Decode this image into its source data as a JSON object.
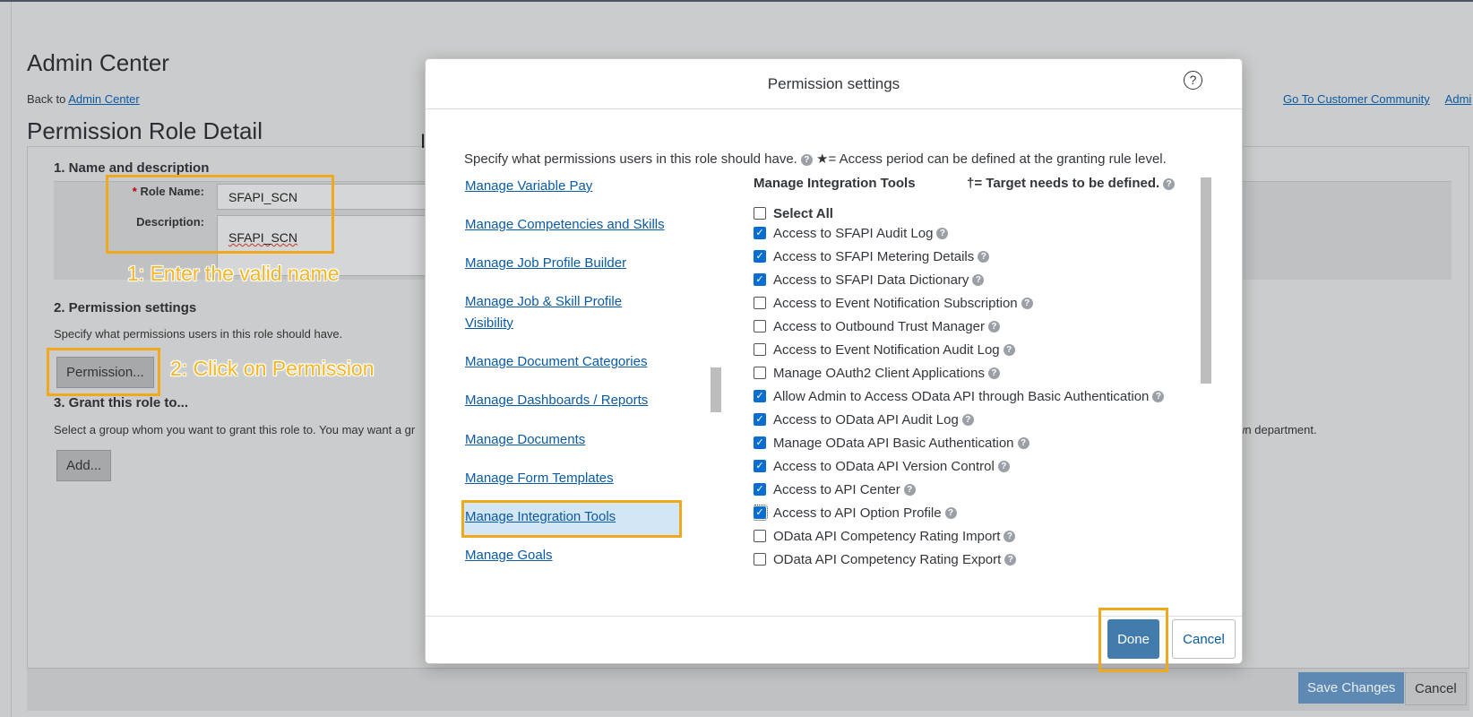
{
  "page": {
    "admin_title": "Admin Center",
    "back_prefix": "Back to ",
    "back_link": "Admin Center",
    "top_links": [
      "Go To Customer Community",
      "Admi"
    ],
    "role_detail_title": "Permission Role Detail",
    "section1": "1. Name and description",
    "role_name_label": "Role Name:",
    "role_name_required": "*",
    "role_name_value": "SFAPI_SCN",
    "description_label": "Description:",
    "description_value": "SFAPI_SCN",
    "section2": "2. Permission settings",
    "section2_help": "Specify what permissions users in this role should have.",
    "permission_button": "Permission...",
    "section3": "3. Grant this role to...",
    "section3_help_left": "Select a group whom you want to grant this role to. You may want a gr",
    "section3_help_right": "wn department.",
    "add_button": "Add...",
    "save_changes": "Save Changes",
    "cancel": "Cancel"
  },
  "annotations": {
    "step1": "1: Enter the valid name",
    "step2": "2: Click on Permission"
  },
  "dialog": {
    "title": "Permission settings",
    "help_icon": "question-circle-icon",
    "intro": "Specify what permissions users in this role should have.",
    "access_note": "★= Access period can be defined at the granting rule level.",
    "target_note": "†= Target needs to be defined.",
    "categories": [
      "Manage Variable Pay",
      "Manage Competencies and Skills",
      "Manage Job Profile Builder",
      "Manage Job & Skill Profile Visibility",
      "Manage Document Categories",
      "Manage Dashboards / Reports",
      "Manage Documents",
      "Manage Form Templates",
      "Manage Integration Tools",
      "Manage Goals"
    ],
    "selected_category": "Manage Integration Tools",
    "section_header": "Manage Integration Tools",
    "select_all": "Select All",
    "permissions": [
      {
        "label": "Access to SFAPI Audit Log",
        "checked": true
      },
      {
        "label": "Access to SFAPI Metering Details",
        "checked": true
      },
      {
        "label": "Access to SFAPI Data Dictionary",
        "checked": true
      },
      {
        "label": "Access to Event Notification Subscription",
        "checked": false
      },
      {
        "label": "Access to Outbound Trust Manager",
        "checked": false
      },
      {
        "label": "Access to Event Notification Audit Log",
        "checked": false
      },
      {
        "label": "Manage OAuth2 Client Applications",
        "checked": false
      },
      {
        "label": "Allow Admin to Access OData API through Basic Authentication",
        "checked": true
      },
      {
        "label": "Access to OData API Audit Log",
        "checked": true
      },
      {
        "label": "Manage OData API Basic Authentication",
        "checked": true
      },
      {
        "label": "Access to OData API Version Control",
        "checked": true
      },
      {
        "label": "Access to API Center",
        "checked": true
      },
      {
        "label": "Access to API Option Profile",
        "checked": true
      },
      {
        "label": "OData API Competency Rating Import",
        "checked": false
      },
      {
        "label": "OData API Competency Rating Export",
        "checked": false
      }
    ],
    "done": "Done",
    "cancel": "Cancel"
  }
}
